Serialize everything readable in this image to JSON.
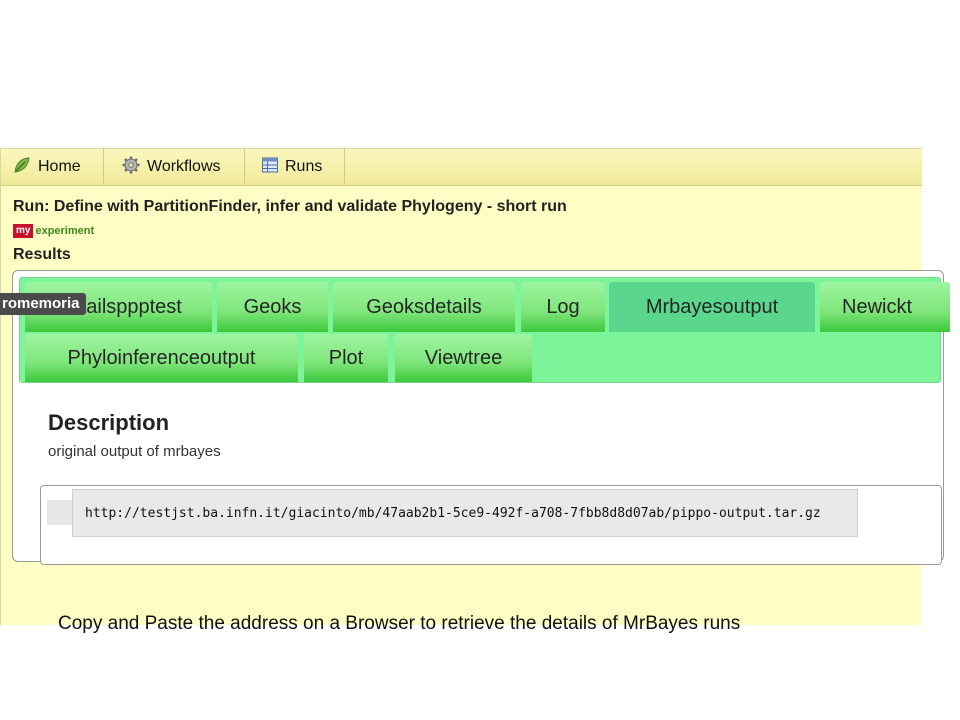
{
  "nav": {
    "tabs": [
      {
        "label": "Home",
        "icon": "leaf-icon"
      },
      {
        "label": "Workflows",
        "icon": "gear-icon"
      },
      {
        "label": "Runs",
        "icon": "table-icon"
      }
    ]
  },
  "run": {
    "title": "Run: Define with PartitionFinder, infer and validate Phylogeny - short run",
    "logo_my": "my",
    "logo_experiment": "experiment",
    "results_label": "Results"
  },
  "result_tabs": {
    "row1": [
      "Detailsppptest",
      "Geoks",
      "Geoksdetails",
      "Log",
      "Mrbayesoutput",
      "Newickt"
    ],
    "row2": [
      "Phyloinferenceoutput",
      "Plot",
      "Viewtree"
    ],
    "active": "Mrbayesoutput"
  },
  "overlay": {
    "promemoria": "romemoria"
  },
  "description": {
    "heading": "Description",
    "text": "original output of mrbayes"
  },
  "output_url": "http://testjst.ba.infn.it/giacinto/mb/47aab2b1-5ce9-492f-a708-7fbb8d8d07ab/pippo-output.tar.gz",
  "caption": "Copy and Paste the address on a Browser  to retrieve the details of MrBayes runs",
  "colors": {
    "app_background": "#fefdc3",
    "tab_area": "#7ef49a",
    "tab_active": "#5ad78c",
    "logo_red": "#c8102e",
    "logo_green": "#3a8a1a"
  }
}
